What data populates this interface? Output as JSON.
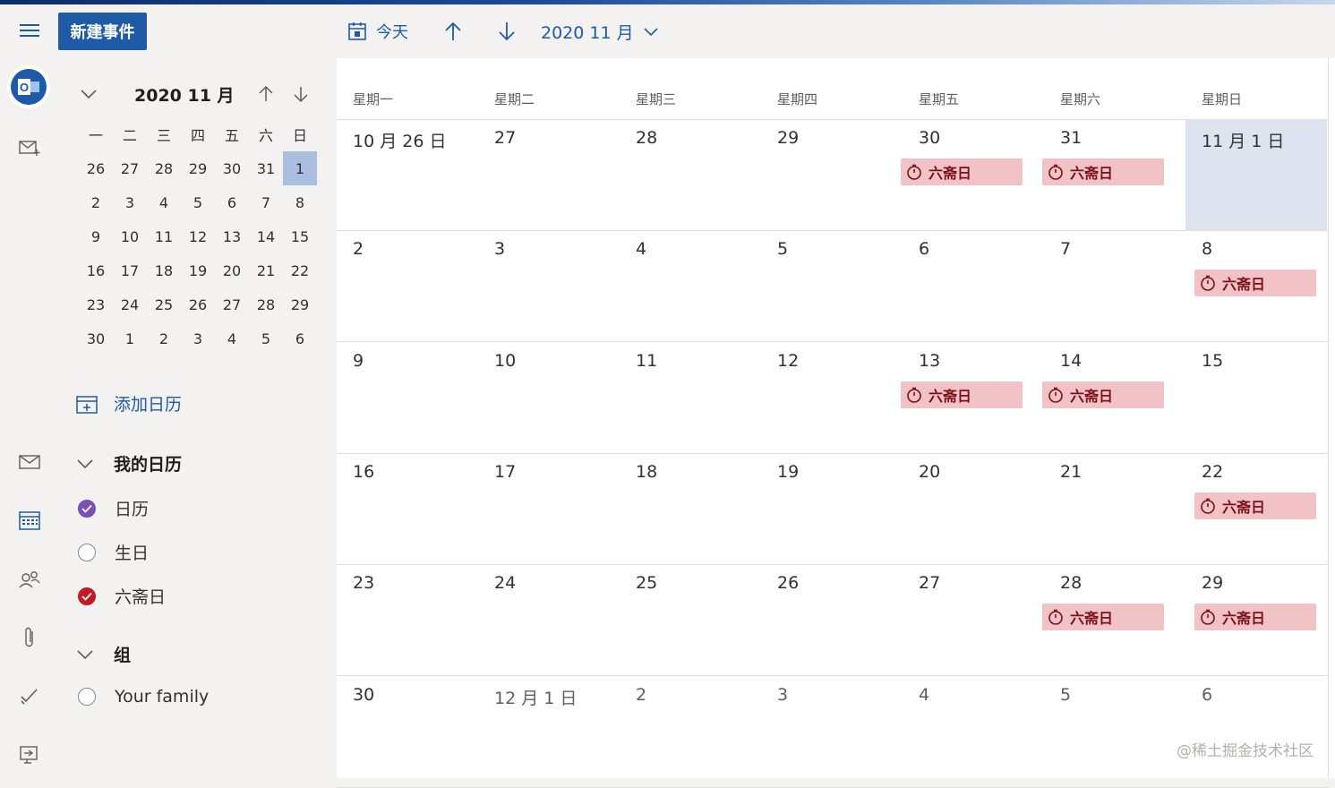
{
  "header": {
    "new_event": "新建事件",
    "today": "今天",
    "period": "2020 11 月"
  },
  "mini_calendar": {
    "title": "2020 11 月",
    "weekdays": [
      "一",
      "二",
      "三",
      "四",
      "五",
      "六",
      "日"
    ],
    "weeks": [
      [
        "26",
        "27",
        "28",
        "29",
        "30",
        "31",
        "1"
      ],
      [
        "2",
        "3",
        "4",
        "5",
        "6",
        "7",
        "8"
      ],
      [
        "9",
        "10",
        "11",
        "12",
        "13",
        "14",
        "15"
      ],
      [
        "16",
        "17",
        "18",
        "19",
        "20",
        "21",
        "22"
      ],
      [
        "23",
        "24",
        "25",
        "26",
        "27",
        "28",
        "29"
      ],
      [
        "30",
        "1",
        "2",
        "3",
        "4",
        "5",
        "6"
      ]
    ],
    "selected": "1"
  },
  "sidebar": {
    "add_calendar": "添加日历",
    "my_calendars": {
      "title": "我的日历",
      "items": [
        {
          "label": "日历",
          "checked": true,
          "color": "#7b4fb3"
        },
        {
          "label": "生日",
          "checked": false,
          "color": ""
        },
        {
          "label": "六斋日",
          "checked": true,
          "color": "#c01c28"
        }
      ]
    },
    "groups": {
      "title": "组",
      "items": [
        {
          "label": "Your family",
          "checked": false
        }
      ]
    }
  },
  "month_view": {
    "weekdays": [
      "星期一",
      "星期二",
      "星期三",
      "星期四",
      "星期五",
      "星期六",
      "星期日"
    ],
    "weeks": [
      [
        {
          "d": "10 月 26 日"
        },
        {
          "d": "27"
        },
        {
          "d": "28"
        },
        {
          "d": "29"
        },
        {
          "d": "30",
          "ev": "六斋日"
        },
        {
          "d": "31",
          "ev": "六斋日"
        },
        {
          "d": "11 月 1 日",
          "today": true
        }
      ],
      [
        {
          "d": "2"
        },
        {
          "d": "3"
        },
        {
          "d": "4"
        },
        {
          "d": "5"
        },
        {
          "d": "6"
        },
        {
          "d": "7"
        },
        {
          "d": "8",
          "ev": "六斋日"
        }
      ],
      [
        {
          "d": "9"
        },
        {
          "d": "10"
        },
        {
          "d": "11"
        },
        {
          "d": "12"
        },
        {
          "d": "13",
          "ev": "六斋日"
        },
        {
          "d": "14",
          "ev": "六斋日"
        },
        {
          "d": "15"
        }
      ],
      [
        {
          "d": "16"
        },
        {
          "d": "17"
        },
        {
          "d": "18"
        },
        {
          "d": "19"
        },
        {
          "d": "20"
        },
        {
          "d": "21"
        },
        {
          "d": "22",
          "ev": "六斋日"
        }
      ],
      [
        {
          "d": "23"
        },
        {
          "d": "24"
        },
        {
          "d": "25"
        },
        {
          "d": "26"
        },
        {
          "d": "27"
        },
        {
          "d": "28",
          "ev": "六斋日"
        },
        {
          "d": "29",
          "ev": "六斋日"
        }
      ],
      [
        {
          "d": "30"
        },
        {
          "d": "12 月 1 日",
          "other": true
        },
        {
          "d": "2",
          "other": true
        },
        {
          "d": "3",
          "other": true
        },
        {
          "d": "4",
          "other": true
        },
        {
          "d": "5",
          "other": true
        },
        {
          "d": "6",
          "other": true
        }
      ]
    ]
  },
  "colors": {
    "accent": "#1f5aa6",
    "event_bg": "#f1c3c7",
    "event_text": "#7a1018"
  },
  "watermark": "@稀土掘金技术社区"
}
